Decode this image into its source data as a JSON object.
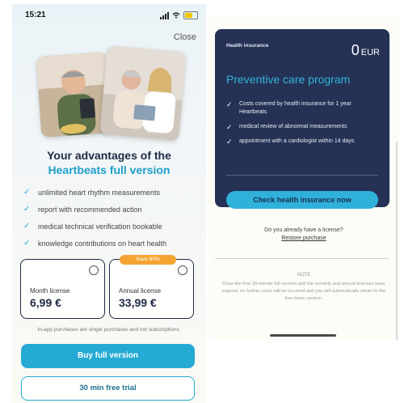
{
  "left": {
    "status": {
      "time": "15:21"
    },
    "close_label": "Close",
    "headline": {
      "line1": "Your advantages of the",
      "line2": "Heartbeats full version"
    },
    "benefits": [
      "unlimited heart rhythm measurements",
      "report with recommended action",
      "medical technical verification bookable",
      "knowledge contributions on heart health"
    ],
    "plans": [
      {
        "name": "Month license",
        "price": "6,99 €"
      },
      {
        "name": "Annual license",
        "price": "33,99 €"
      }
    ],
    "badge": "Save 60%",
    "inapp_note": "In-app purchases are single purchases and not subscriptions.",
    "buy_button": "Buy full version",
    "trial_button": "30 min free trial"
  },
  "right": {
    "card": {
      "label": "Health insurance",
      "price_value": "0",
      "price_currency": "EUR",
      "title": "Preventive care program",
      "items": [
        "Costs covered by health insurance for 1 year Heartbeats",
        "medical review of abnormal measurements",
        "appointment with a cardiologist within 14 days"
      ],
      "button": "Check health insurance now"
    },
    "license_question": "Do you already have a license?",
    "restore_link": "Restore purchase",
    "note_title": "NOTE",
    "note_text": "Once the free 30-minute full version and the monthly and annual licenses have expired, no further costs will be incurred and you will automatically return to the free basic version."
  },
  "colors": {
    "accent": "#25aad4",
    "navy": "#253255",
    "badge": "#f3a433"
  }
}
